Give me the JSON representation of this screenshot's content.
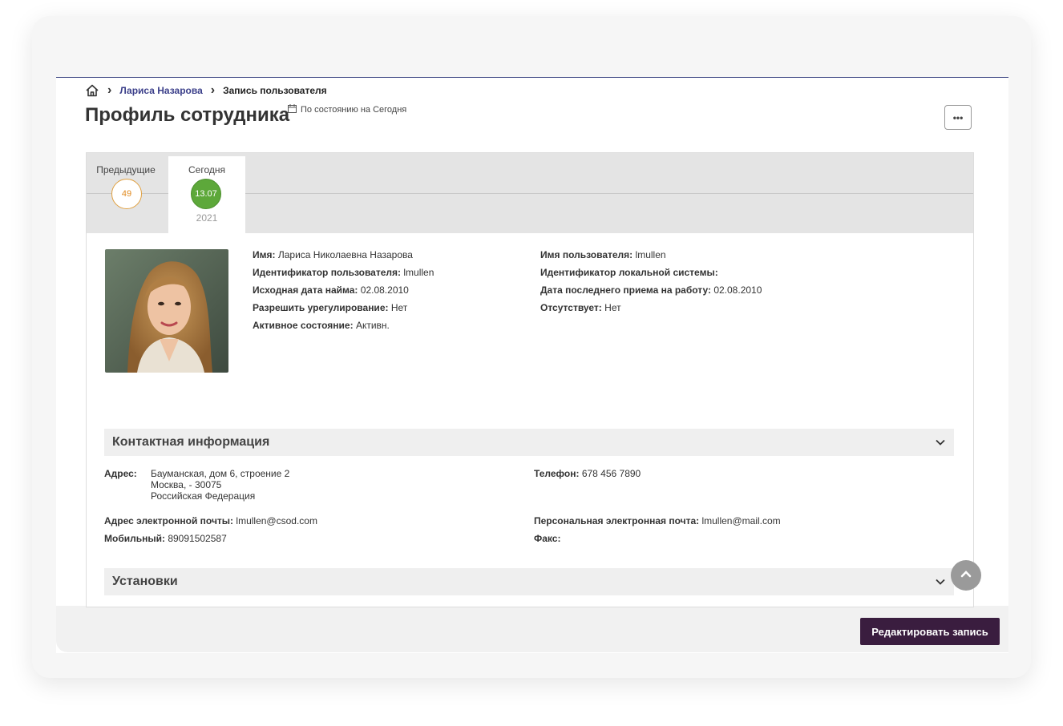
{
  "breadcrumb": {
    "home_icon": "home-icon",
    "link": "Лариса Назарова",
    "current": "Запись пользователя"
  },
  "header": {
    "title": "Профиль сотрудника",
    "as_of": "По состоянию на Сегодня",
    "calendar_icon": "calendar-icon",
    "more_label": "•••"
  },
  "timeline": {
    "prev_label": "Предыдущие",
    "prev_count": "49",
    "today_label": "Сегодня",
    "today_date": "13.07",
    "today_year": "2021"
  },
  "profile": {
    "left": [
      {
        "label": "Имя:",
        "value": "Лариса Николаевна Назарова"
      },
      {
        "label": "Идентификатор пользователя:",
        "value": "lmullen"
      },
      {
        "label": "Исходная дата найма:",
        "value": "02.08.2010"
      },
      {
        "label": "Разрешить урегулирование:",
        "value": "Нет"
      },
      {
        "label": "Активное состояние:",
        "value": "Активн."
      }
    ],
    "right": [
      {
        "label": "Имя пользователя:",
        "value": "lmullen"
      },
      {
        "label": "Идентификатор локальной системы:",
        "value": ""
      },
      {
        "label": "Дата последнего приема на работу:",
        "value": "02.08.2010"
      },
      {
        "label": "Отсутствует:",
        "value": "Нет"
      }
    ]
  },
  "contact": {
    "section_title": "Контактная информация",
    "address_label": "Адрес:",
    "address_lines": [
      "Бауманская, дом 6, строение 2",
      "Москва, - 30075",
      "Российская Федерация"
    ],
    "phone_label": "Телефон:",
    "phone": "678 456 7890",
    "email_label": "Адрес электронной почты:",
    "email": "lmullen@csod.com",
    "personal_email_label": "Персональная электронная почта:",
    "personal_email": "lmullen@mail.com",
    "mobile_label": "Мобильный:",
    "mobile": "89091502587",
    "fax_label": "Факс:",
    "fax": ""
  },
  "settings": {
    "section_title": "Установки"
  },
  "actions": {
    "edit_label": "Редактировать запись"
  },
  "colors": {
    "accent": "#3a1d3f",
    "today_green": "#5da83a",
    "prev_orange": "#e08a20",
    "breadcrumb_link": "#3b3f8a"
  }
}
